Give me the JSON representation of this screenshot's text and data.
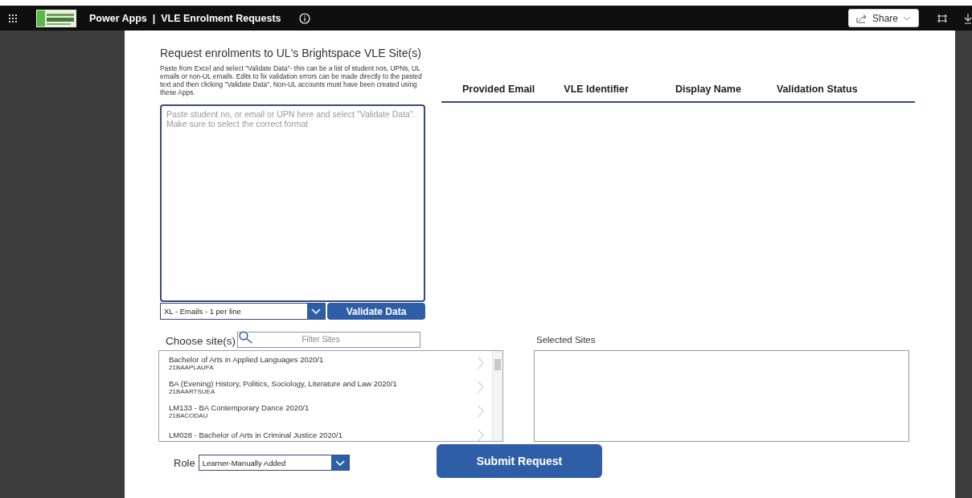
{
  "top_bar": {
    "app_title": "Power Apps  |  VLE Enrolment Requests",
    "share_button": "Share"
  },
  "form": {
    "title": "Request enrolments to UL's Brightspace VLE Site(s)",
    "instructions": "Paste from Excel and select \"Validate Data\"- this can be a list of student nos, UPNs, UL emails or non-UL emails. Edits to fix validation errors can be made directly to the pasted text and then clicking \"Validate Data\". Non-UL accounts must have been created using these Apps.",
    "paste_box": {
      "placeholder": "Paste student no, or email or UPN here and select \"Validate Data\". Make sure to select the correct format"
    },
    "format_dropdown": "XL - Emails - 1 per line",
    "validate_button": "Validate Data",
    "choose_label": "Choose site(s)",
    "filter": {
      "placeholder": "Filter Sites"
    },
    "sites": [
      {
        "name": "Bachelor of Arts in Applied Languages  2020/1",
        "code": "21BAAPLAUFA"
      },
      {
        "name": "BA (Evening) History, Politics, Sociology, Literature and Law 2020/1",
        "code": "21BAARTSUEA"
      },
      {
        "name": "LM133 - BA Contemporary Dance 2020/1",
        "code": "21BACODAU"
      },
      {
        "name": "LM028 - Bachelor of Arts in Criminal Justice 2020/1"
      }
    ],
    "role_label": "Role",
    "role_dropdown": "Learner-Manually Added",
    "selected_label": "Selected Sites",
    "submit_button": "Submit Request"
  },
  "table": {
    "columns": [
      "Provided Email",
      "VLE Identifier",
      "Display Name",
      "Validation Status"
    ]
  }
}
